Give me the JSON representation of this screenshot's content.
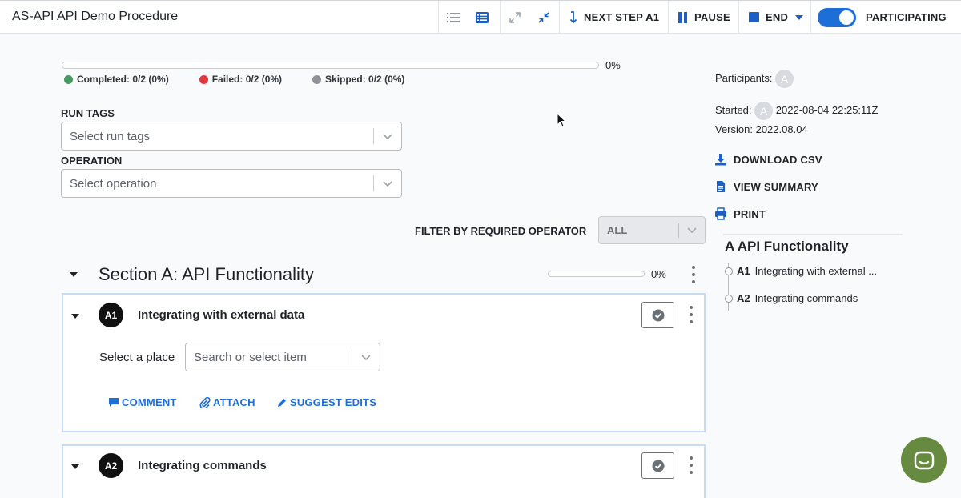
{
  "app": {
    "title": "AS-API API Demo Procedure"
  },
  "toolbar": {
    "next_step_label": "NEXT STEP A1",
    "pause_label": "PAUSE",
    "end_label": "END",
    "participating_label": "PARTICIPATING"
  },
  "progress": {
    "overall_percent_text": "0%",
    "overall_fraction": 0,
    "completed": "Completed: 0/2 (0%)",
    "failed": "Failed: 0/2 (0%)",
    "skipped": "Skipped: 0/2 (0%)"
  },
  "filters": {
    "run_tags_label": "RUN TAGS",
    "run_tags_placeholder": "Select run tags",
    "operation_label": "OPERATION",
    "operation_placeholder": "Select operation",
    "required_operator_label": "FILTER BY REQUIRED OPERATOR",
    "required_operator_value": "ALL"
  },
  "section": {
    "title": "Section A: API Functionality",
    "percent_text": "0%",
    "fraction": 0
  },
  "steps": [
    {
      "badge": "A1",
      "title": "Integrating with external data",
      "field_label": "Select a place",
      "field_placeholder": "Search or select item",
      "actions": {
        "comment": "COMMENT",
        "attach": "ATTACH",
        "suggest": "SUGGEST EDITS"
      }
    },
    {
      "badge": "A2",
      "title": "Integrating commands"
    }
  ],
  "side_panel": {
    "participants_label": "Participants:",
    "participant_avatar": "A",
    "started_label": "Started:",
    "started_avatar": "A",
    "started_time": "2022-08-04 22:25:11Z",
    "version": "Version: 2022.08.04",
    "download_csv": "DOWNLOAD CSV",
    "view_summary": "VIEW SUMMARY",
    "print": "PRINT",
    "outline_title": "A API Functionality",
    "outline_items": [
      {
        "id": "A1",
        "label": "Integrating with external ..."
      },
      {
        "id": "A2",
        "label": "Integrating commands"
      }
    ]
  },
  "colors": {
    "accent": "#1e6ed8",
    "completed": "#4a9a64",
    "failed": "#e0393e",
    "skipped": "#8e9297",
    "chat": "#668a3f"
  }
}
